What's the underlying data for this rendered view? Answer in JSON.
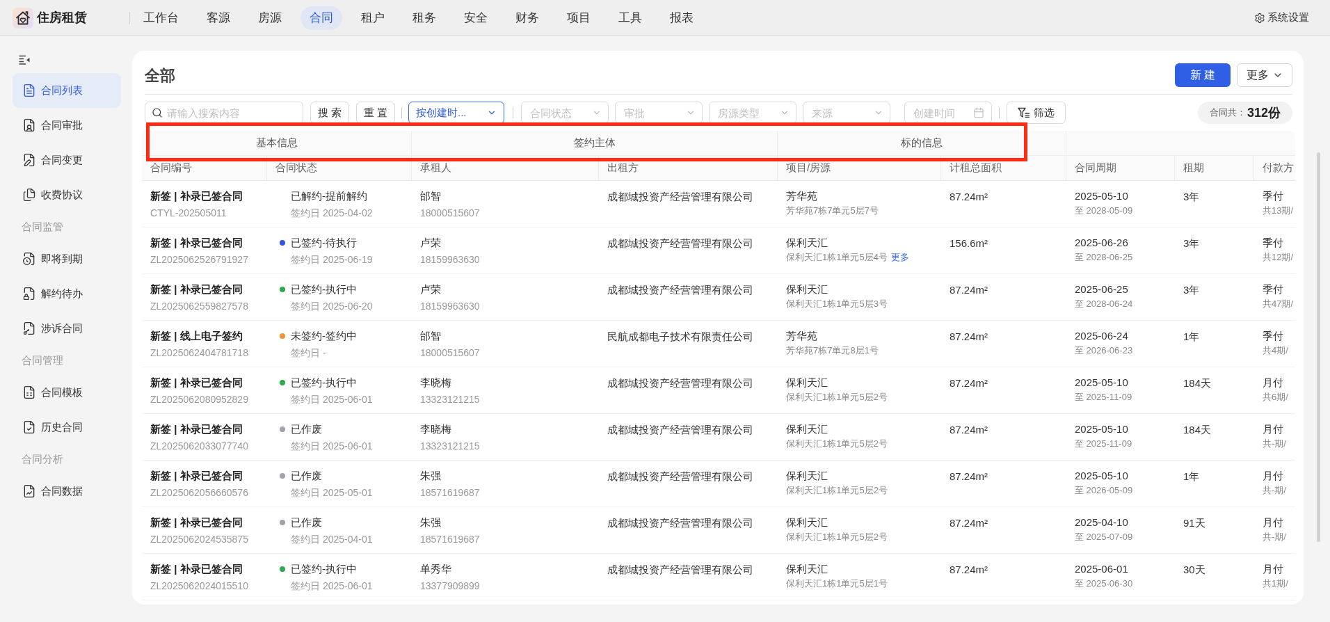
{
  "header": {
    "app_name": "住房租赁",
    "nav": [
      {
        "label": "工作台",
        "selected": false
      },
      {
        "label": "客源",
        "selected": false
      },
      {
        "label": "房源",
        "selected": false
      },
      {
        "label": "合同",
        "selected": true
      },
      {
        "label": "租户",
        "selected": false
      },
      {
        "label": "租务",
        "selected": false
      },
      {
        "label": "安全",
        "selected": false
      },
      {
        "label": "财务",
        "selected": false
      },
      {
        "label": "项目",
        "selected": false
      },
      {
        "label": "工具",
        "selected": false
      },
      {
        "label": "报表",
        "selected": false
      }
    ],
    "settings": "系统设置"
  },
  "sidebar": {
    "groups": [
      {
        "items": [
          {
            "label": "合同列表",
            "selected": true
          },
          {
            "label": "合同审批",
            "selected": false
          },
          {
            "label": "合同变更",
            "selected": false
          },
          {
            "label": "收费协议",
            "selected": false
          }
        ]
      },
      {
        "title": "合同监管",
        "items": [
          {
            "label": "即将到期",
            "selected": false
          },
          {
            "label": "解约待办",
            "selected": false
          },
          {
            "label": "涉诉合同",
            "selected": false
          }
        ]
      },
      {
        "title": "合同管理",
        "items": [
          {
            "label": "合同模板",
            "selected": false
          },
          {
            "label": "历史合同",
            "selected": false
          }
        ]
      },
      {
        "title": "合同分析",
        "items": [
          {
            "label": "合同数据",
            "selected": false
          }
        ]
      }
    ]
  },
  "content": {
    "title": "全部",
    "actions": [
      {
        "label": "新 建",
        "kind": "primary"
      },
      {
        "label": "更多",
        "kind": "dropdown"
      }
    ],
    "filters": {
      "search": {
        "placeholder": "请输入搜索内容"
      },
      "buttons": [
        "搜 索",
        "重 置"
      ],
      "sort": {
        "value": "按创建时..."
      },
      "selects": [
        {
          "placeholder": "合同状态"
        },
        {
          "placeholder": "审批"
        },
        {
          "placeholder": "房源类型"
        },
        {
          "placeholder": "来源"
        }
      ],
      "date": {
        "placeholder": "创建时间"
      },
      "filter_button": "筛选"
    },
    "count": {
      "label": "合同共：",
      "value": "312份"
    }
  },
  "table": {
    "column_groups": [
      {
        "label": "基本信息",
        "columns": [
          "合同编号",
          "合同状态"
        ]
      },
      {
        "label": "签约主体",
        "columns": [
          "承租人",
          "出租方"
        ]
      },
      {
        "label": "标的信息",
        "columns": [
          "项目/房源",
          "计租总面积"
        ]
      },
      {
        "columns": [
          "合同周期",
          "租期",
          "付款方"
        ]
      }
    ],
    "rows": [
      {
        "title": "新签 | 补录已签合同",
        "number": "CTYL-202505011",
        "status": "已解约-提前解约",
        "signed": "签约日 2025-04-02",
        "tenant": "邰智",
        "phone": "18000515607",
        "landlord": "成都城投资产经营管理有限公司",
        "project": "芳华苑",
        "unit": "芳华苑7栋7单元5层7号",
        "area": "87.24m²",
        "start": "2025-05-10",
        "end": "至 2028-05-09",
        "term": "3年",
        "payment": "季付",
        "periods": "共13期/"
      },
      {
        "title": "新签 | 补录已签合同",
        "number": "ZL2025062526791927",
        "status": "已签约-待执行",
        "color": "#3355e0",
        "signed": "签约日 2025-06-19",
        "tenant": "卢荣",
        "phone": "18159963630",
        "landlord": "成都城投资产经营管理有限公司",
        "project": "保利天汇",
        "unit": "保利天汇1栋1单元5层4号",
        "more": "更多",
        "area": "156.6m²",
        "start": "2025-06-26",
        "end": "至 2028-06-25",
        "term": "3年",
        "payment": "季付",
        "periods": "共12期/"
      },
      {
        "title": "新签 | 补录已签合同",
        "number": "ZL2025062559827578",
        "status": "已签约-执行中",
        "color": "#2fa84f",
        "signed": "签约日 2025-06-20",
        "tenant": "卢荣",
        "phone": "18159963630",
        "landlord": "成都城投资产经营管理有限公司",
        "project": "保利天汇",
        "unit": "保利天汇1栋1单元5层3号",
        "area": "87.24m²",
        "start": "2025-06-25",
        "end": "至 2028-06-24",
        "term": "3年",
        "payment": "季付",
        "periods": "共47期/"
      },
      {
        "title": "新签 | 线上电子签约",
        "number": "ZL2025062404781718",
        "status": "未签约-签约中",
        "color": "#f0923a",
        "signed": "签约日 -",
        "tenant": "邰智",
        "phone": "18000515607",
        "landlord": "民航成都电子技术有限责任公司",
        "project": "芳华苑",
        "unit": "芳华苑7栋7单元8层1号",
        "area": "87.24m²",
        "start": "2025-06-24",
        "end": "至 2026-06-23",
        "term": "1年",
        "payment": "季付",
        "periods": "共4期/"
      },
      {
        "title": "新签 | 补录已签合同",
        "number": "ZL2025062080952829",
        "status": "已签约-执行中",
        "color": "#2fa84f",
        "signed": "签约日 2025-06-01",
        "tenant": "李晓梅",
        "phone": "13323121215",
        "landlord": "成都城投资产经营管理有限公司",
        "project": "保利天汇",
        "unit": "保利天汇1栋1单元5层2号",
        "area": "87.24m²",
        "start": "2025-05-10",
        "end": "至 2025-11-09",
        "term": "184天",
        "payment": "月付",
        "periods": "共6期/"
      },
      {
        "title": "新签 | 补录已签合同",
        "number": "ZL2025062033077740",
        "status": "已作废",
        "color": "#a0a3ad",
        "signed": "签约日 2025-06-01",
        "tenant": "李晓梅",
        "phone": "13323121215",
        "landlord": "成都城投资产经营管理有限公司",
        "project": "保利天汇",
        "unit": "保利天汇1栋1单元5层2号",
        "area": "87.24m²",
        "start": "2025-05-10",
        "end": "至 2025-11-09",
        "term": "184天",
        "payment": "月付",
        "periods": "共-期/"
      },
      {
        "title": "新签 | 补录已签合同",
        "number": "ZL2025062056660576",
        "status": "已作废",
        "color": "#a0a3ad",
        "signed": "签约日 2025-05-01",
        "tenant": "朱强",
        "phone": "18571619687",
        "landlord": "成都城投资产经营管理有限公司",
        "project": "保利天汇",
        "unit": "保利天汇1栋1单元5层2号",
        "area": "87.24m²",
        "start": "2025-05-10",
        "end": "至 2026-05-09",
        "term": "1年",
        "payment": "月付",
        "periods": "共-期/"
      },
      {
        "title": "新签 | 补录已签合同",
        "number": "ZL2025062024535875",
        "status": "已作废",
        "color": "#a0a3ad",
        "signed": "签约日 2025-04-01",
        "tenant": "朱强",
        "phone": "18571619687",
        "landlord": "成都城投资产经营管理有限公司",
        "project": "保利天汇",
        "unit": "保利天汇1栋1单元5层2号",
        "area": "87.24m²",
        "start": "2025-04-10",
        "end": "至 2025-07-09",
        "term": "91天",
        "payment": "月付",
        "periods": "共-期/"
      },
      {
        "title": "新签 | 补录已签合同",
        "number": "ZL2025062024015510",
        "status": "已签约-执行中",
        "color": "#2fa84f",
        "signed": "签约日 2025-06-01",
        "tenant": "单秀华",
        "phone": "13377909899",
        "landlord": "成都城投资产经营管理有限公司",
        "project": "保利天汇",
        "unit": "保利天汇1栋1单元5层1号",
        "area": "87.24m²",
        "start": "2025-06-01",
        "end": "至 2025-06-30",
        "term": "30天",
        "payment": "月付",
        "periods": "共1期/"
      }
    ]
  }
}
